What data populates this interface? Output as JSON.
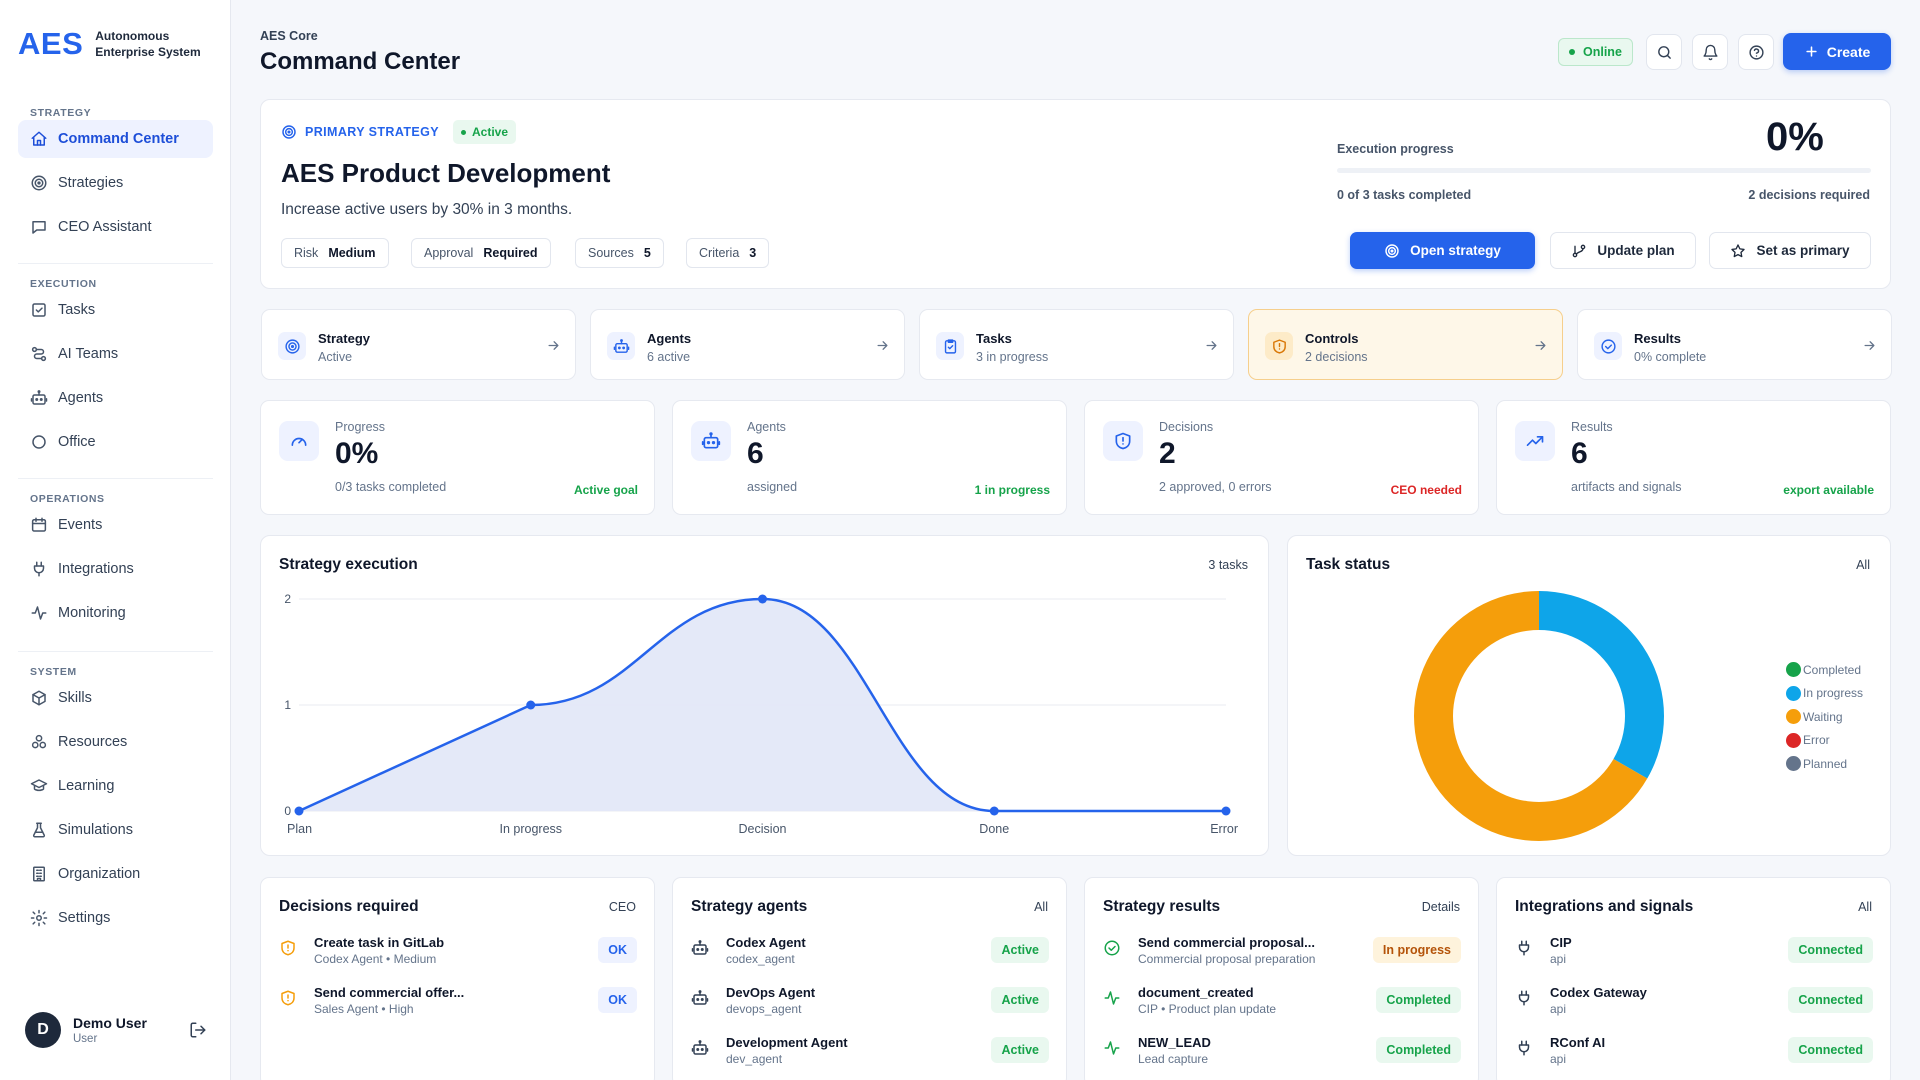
{
  "brand": {
    "mark": "AES",
    "subtitle": "Autonomous Enterprise System"
  },
  "sidebar": {
    "sections": [
      {
        "title": "STRATEGY",
        "items": [
          {
            "label": "Command Center",
            "icon": "home-icon",
            "active": true
          },
          {
            "label": "Strategies",
            "icon": "target-icon"
          },
          {
            "label": "CEO Assistant",
            "icon": "chat-icon"
          }
        ]
      },
      {
        "title": "EXECUTION",
        "items": [
          {
            "label": "Tasks",
            "icon": "checkbox-icon"
          },
          {
            "label": "AI Teams",
            "icon": "route-icon"
          },
          {
            "label": "Agents",
            "icon": "robot-icon"
          },
          {
            "label": "Office",
            "icon": "circle-icon"
          }
        ]
      },
      {
        "title": "OPERATIONS",
        "items": [
          {
            "label": "Events",
            "icon": "calendar-icon"
          },
          {
            "label": "Integrations",
            "icon": "plug-icon"
          },
          {
            "label": "Monitoring",
            "icon": "activity-icon"
          }
        ]
      },
      {
        "title": "SYSTEM",
        "items": [
          {
            "label": "Skills",
            "icon": "puzzle-icon"
          },
          {
            "label": "Resources",
            "icon": "boxes-icon"
          },
          {
            "label": "Learning",
            "icon": "graduation-cap-icon"
          },
          {
            "label": "Simulations",
            "icon": "flask-icon"
          },
          {
            "label": "Organization",
            "icon": "building-icon"
          },
          {
            "label": "Settings",
            "icon": "gear-icon"
          }
        ]
      }
    ],
    "user": {
      "initial": "D",
      "name": "Demo User",
      "role": "User"
    }
  },
  "header": {
    "breadcrumb": "AES Core",
    "title": "Command Center",
    "status": "Online",
    "create_label": "Create"
  },
  "hero": {
    "label": "PRIMARY STRATEGY",
    "badge": "Active",
    "title": "AES Product Development",
    "description": "Increase active users by 30% in 3 months.",
    "chips": [
      {
        "key": "Risk",
        "value": "Medium"
      },
      {
        "key": "Approval",
        "value": "Required"
      },
      {
        "key": "Sources",
        "value": "5"
      },
      {
        "key": "Criteria",
        "value": "3"
      }
    ],
    "progress_label": "Execution progress",
    "progress_value": "0%",
    "progress_fraction": 0,
    "tasks_completed": "0 of 3 tasks completed",
    "decisions_required": "2 decisions required",
    "buttons": {
      "open": "Open strategy",
      "update": "Update plan",
      "primary": "Set as primary"
    }
  },
  "nav_cards": [
    {
      "title": "Strategy",
      "sub": "Active",
      "icon": "target-icon"
    },
    {
      "title": "Agents",
      "sub": "6 active",
      "icon": "robot-icon"
    },
    {
      "title": "Tasks",
      "sub": "3 in progress",
      "icon": "clipboard-check-icon"
    },
    {
      "title": "Controls",
      "sub": "2 decisions",
      "icon": "shield-icon",
      "highlight": true
    },
    {
      "title": "Results",
      "sub": "0% complete",
      "icon": "check-circle-icon"
    }
  ],
  "stats": [
    {
      "label": "Progress",
      "value": "0%",
      "sub": "0/3 tasks completed",
      "note": "Active goal",
      "note_color": "green",
      "icon": "gauge-icon"
    },
    {
      "label": "Agents",
      "value": "6",
      "sub": "assigned",
      "note": "1 in progress",
      "note_color": "green",
      "icon": "robot-icon"
    },
    {
      "label": "Decisions",
      "value": "2",
      "sub": "2 approved, 0 errors",
      "note": "CEO needed",
      "note_color": "red",
      "icon": "shield-alert-icon"
    },
    {
      "label": "Results",
      "value": "6",
      "sub": "artifacts and signals",
      "note": "export available",
      "note_color": "green",
      "icon": "trending-up-icon"
    }
  ],
  "strategy_chart": {
    "title": "Strategy execution",
    "meta": "3 tasks"
  },
  "task_chart": {
    "title": "Task status",
    "meta": "All"
  },
  "chart_data": [
    {
      "type": "area",
      "title": "Strategy execution",
      "categories": [
        "Plan",
        "In progress",
        "Decision",
        "Done",
        "Error"
      ],
      "values": [
        0,
        1,
        2,
        0,
        0
      ],
      "ylim": [
        0,
        2
      ],
      "yticks": [
        "0",
        "1",
        "2"
      ],
      "grid": true,
      "color": "#2563eb"
    },
    {
      "type": "pie",
      "title": "Task status",
      "donut": true,
      "legend_position": "right",
      "labels": [
        "Completed",
        "In progress",
        "Waiting",
        "Error",
        "Planned"
      ],
      "values": [
        0,
        1,
        2,
        0,
        0
      ],
      "colors": [
        "#16a34a",
        "#0ea5e9",
        "#f59e0b",
        "#dc2626",
        "#64748b"
      ]
    }
  ],
  "bottom": [
    {
      "title": "Decisions required",
      "meta": "CEO",
      "rows": [
        {
          "icon": "shield-icon",
          "icon_color": "#f59e0b",
          "title": "Create task in GitLab",
          "sub": "Codex Agent • Medium",
          "pill": "OK",
          "pill_style": "blue"
        },
        {
          "icon": "shield-icon",
          "icon_color": "#f59e0b",
          "title": "Send commercial offer...",
          "sub": "Sales Agent • High",
          "pill": "OK",
          "pill_style": "blue"
        }
      ]
    },
    {
      "title": "Strategy agents",
      "meta": "All",
      "rows": [
        {
          "icon": "robot-icon",
          "icon_color": "#334155",
          "title": "Codex Agent",
          "sub": "codex_agent",
          "pill": "Active",
          "pill_style": "green"
        },
        {
          "icon": "robot-icon",
          "icon_color": "#334155",
          "title": "DevOps Agent",
          "sub": "devops_agent",
          "pill": "Active",
          "pill_style": "green"
        },
        {
          "icon": "robot-icon",
          "icon_color": "#334155",
          "title": "Development Agent",
          "sub": "dev_agent",
          "pill": "Active",
          "pill_style": "green"
        }
      ]
    },
    {
      "title": "Strategy results",
      "meta": "Details",
      "rows": [
        {
          "icon": "check-circle-icon",
          "icon_color": "#16a34a",
          "title": "Send commercial proposal...",
          "sub": "Commercial proposal preparation",
          "pill": "In progress",
          "pill_style": "amber"
        },
        {
          "icon": "activity-icon",
          "icon_color": "#16a34a",
          "title": "document_created",
          "sub": "CIP • Product plan update",
          "pill": "Completed",
          "pill_style": "green"
        },
        {
          "icon": "activity-icon",
          "icon_color": "#16a34a",
          "title": "NEW_LEAD",
          "sub": "Lead capture",
          "pill": "Completed",
          "pill_style": "green"
        }
      ]
    },
    {
      "title": "Integrations and signals",
      "meta": "All",
      "rows": [
        {
          "icon": "plug-icon",
          "icon_color": "#334155",
          "title": "CIP",
          "sub": "api",
          "pill": "Connected",
          "pill_style": "green"
        },
        {
          "icon": "plug-icon",
          "icon_color": "#334155",
          "title": "Codex Gateway",
          "sub": "api",
          "pill": "Connected",
          "pill_style": "green"
        },
        {
          "icon": "plug-icon",
          "icon_color": "#334155",
          "title": "RConf AI",
          "sub": "api",
          "pill": "Connected",
          "pill_style": "green"
        }
      ]
    }
  ]
}
